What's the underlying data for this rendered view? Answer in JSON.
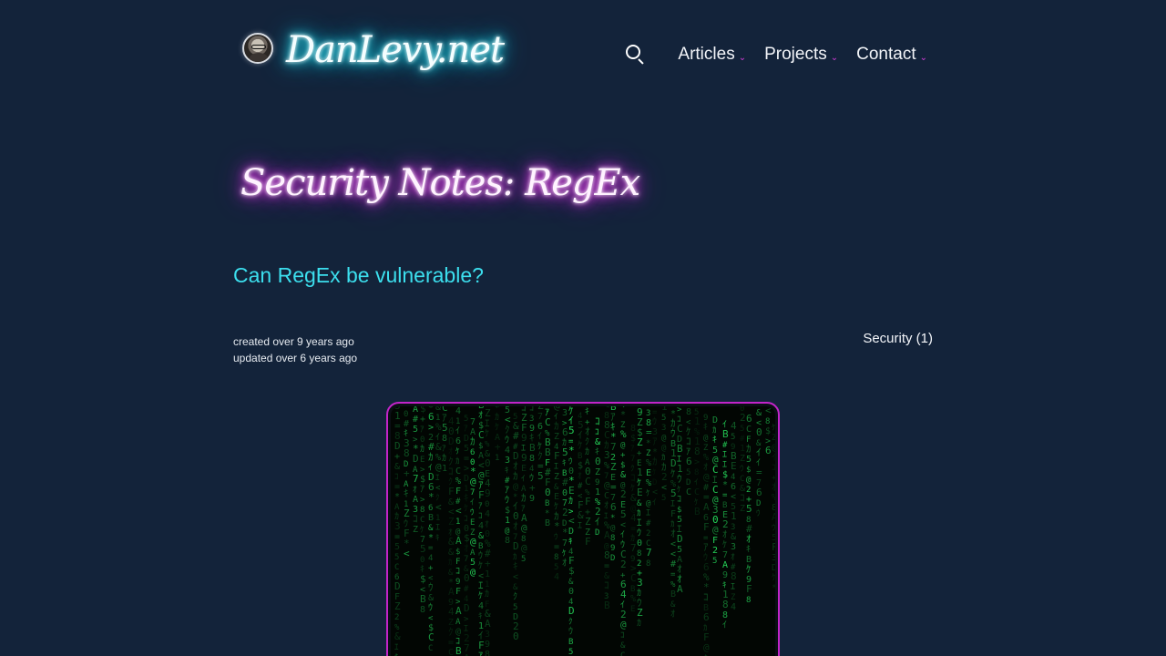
{
  "header": {
    "logo_text": "DanLevy.net",
    "avatar_icon": "avatar-photo",
    "search_icon": "search-icon",
    "nav": [
      {
        "label": "Articles",
        "caret": "⌄"
      },
      {
        "label": "Projects",
        "caret": "⌄"
      },
      {
        "label": "Contact",
        "caret": "⌄"
      }
    ]
  },
  "article": {
    "title": "Security Notes: RegEx",
    "subtitle": "Can RegEx be vulnerable?",
    "created": "created over 9 years ago",
    "updated": "updated over 6 years ago",
    "tag": "Security (1)",
    "hero_image": "matrix-code-rain"
  },
  "colors": {
    "background": "#13233a",
    "logo_glow": "#38f2ff",
    "title_glow": "#f04cf2",
    "subtitle": "#3cdfee",
    "accent_magenta": "#c324c9",
    "matrix_green": "#2cff6a"
  }
}
